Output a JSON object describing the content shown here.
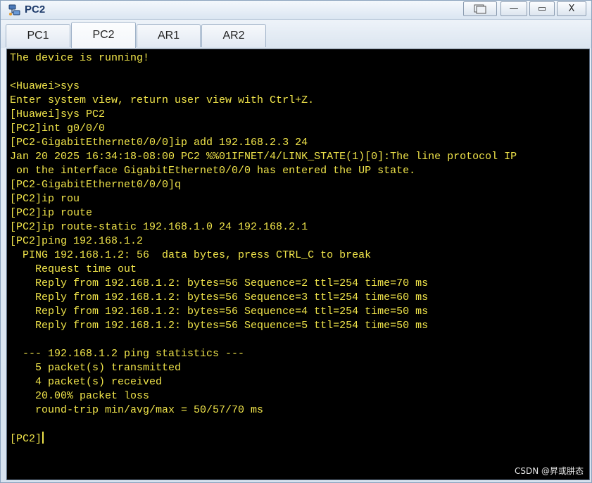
{
  "window": {
    "title": "PC2",
    "controls": {
      "restore": "",
      "minimize": "—",
      "maximize": "▭",
      "close": "X"
    }
  },
  "tabs": [
    "PC1",
    "PC2",
    "AR1",
    "AR2"
  ],
  "active_tab": "PC2",
  "terminal": {
    "text_color": "#f0e44a",
    "background": "#000000",
    "lines": [
      "The device is running!",
      "",
      "<Huawei>sys",
      "Enter system view, return user view with Ctrl+Z.",
      "[Huawei]sys PC2",
      "[PC2]int g0/0/0",
      "[PC2-GigabitEthernet0/0/0]ip add 192.168.2.3 24",
      "Jan 20 2025 16:34:18-08:00 PC2 %%01IFNET/4/LINK_STATE(1)[0]:The line protocol IP",
      " on the interface GigabitEthernet0/0/0 has entered the UP state.",
      "[PC2-GigabitEthernet0/0/0]q",
      "[PC2]ip rou",
      "[PC2]ip route",
      "[PC2]ip route-static 192.168.1.0 24 192.168.2.1",
      "[PC2]ping 192.168.1.2",
      "  PING 192.168.1.2: 56  data bytes, press CTRL_C to break",
      "    Request time out",
      "    Reply from 192.168.1.2: bytes=56 Sequence=2 ttl=254 time=70 ms",
      "    Reply from 192.168.1.2: bytes=56 Sequence=3 ttl=254 time=60 ms",
      "    Reply from 192.168.1.2: bytes=56 Sequence=4 ttl=254 time=50 ms",
      "    Reply from 192.168.1.2: bytes=56 Sequence=5 ttl=254 time=50 ms",
      "",
      "  --- 192.168.1.2 ping statistics ---",
      "    5 packet(s) transmitted",
      "    4 packet(s) received",
      "    20.00% packet loss",
      "    round-trip min/avg/max = 50/57/70 ms",
      "",
      "[PC2]"
    ]
  },
  "watermark": "CSDN @昇或肼态"
}
